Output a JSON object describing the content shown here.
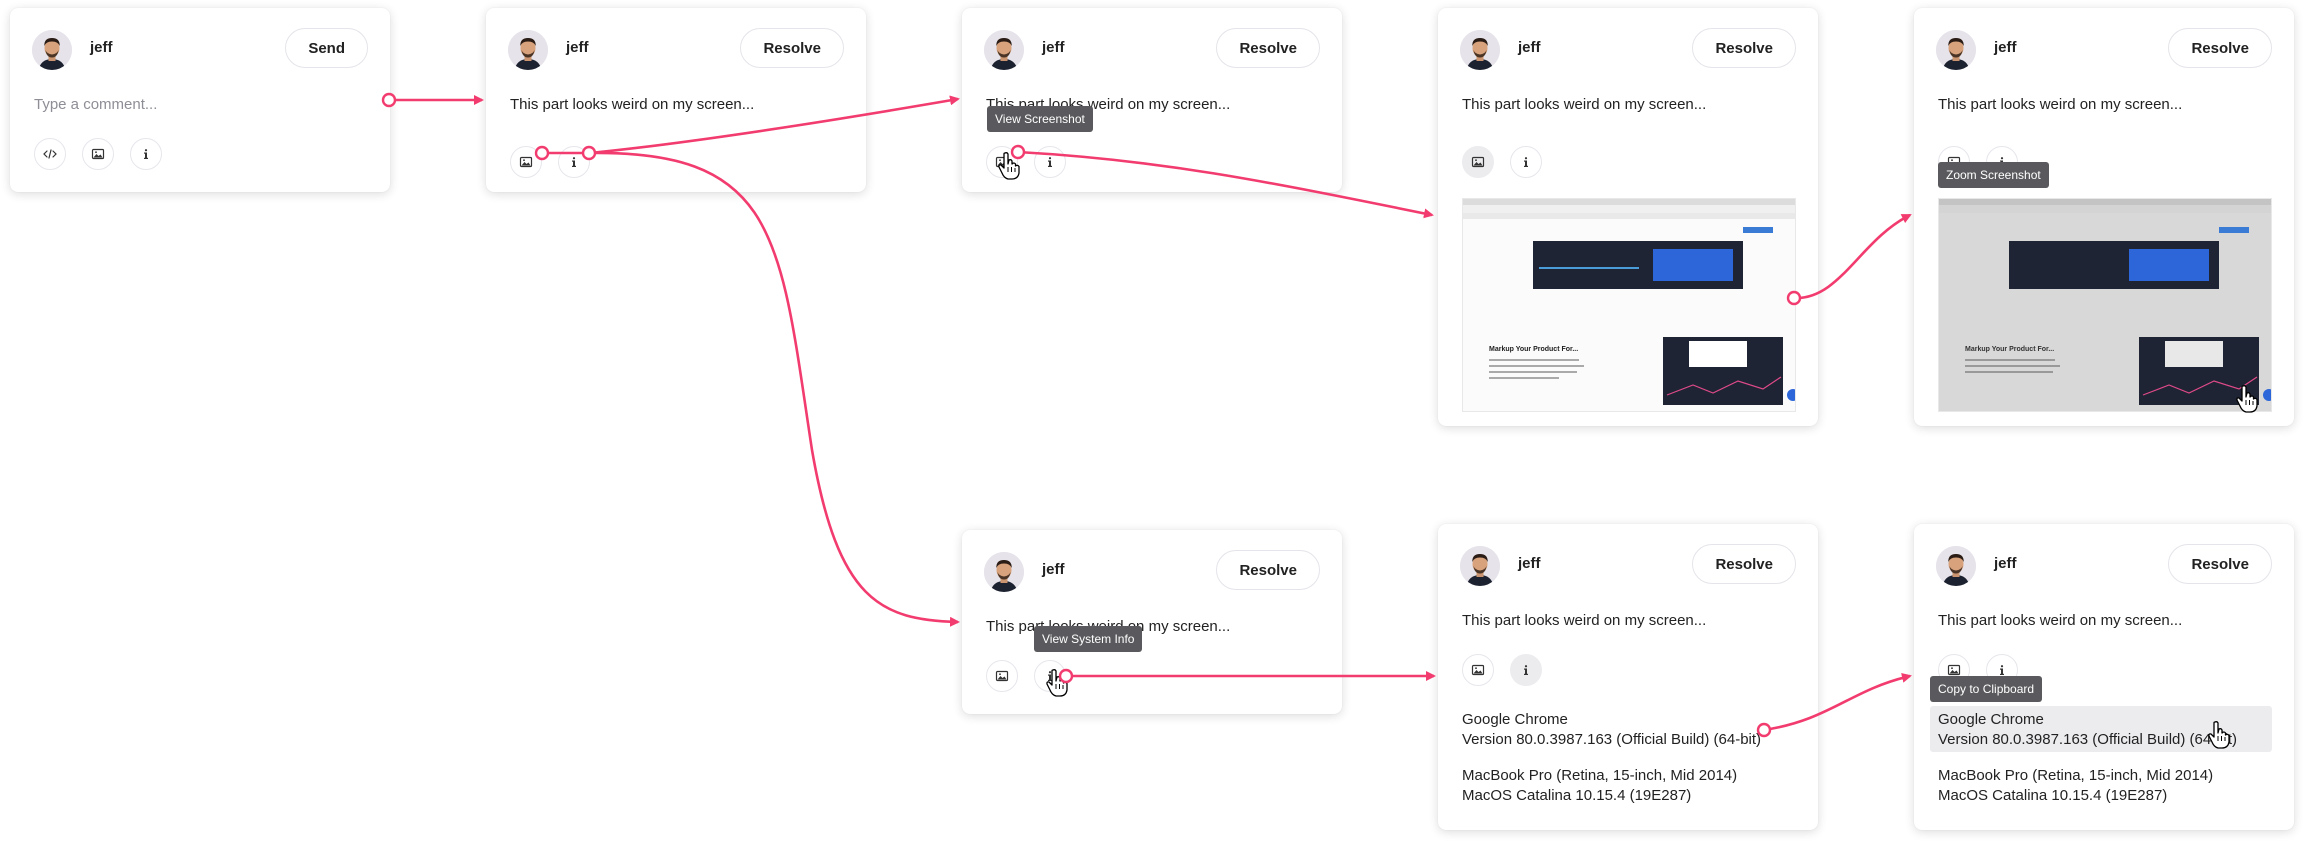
{
  "user": {
    "name": "jeff"
  },
  "buttons": {
    "send": "Send",
    "resolve": "Resolve"
  },
  "comment": {
    "placeholder": "Type a comment...",
    "message": "This part looks weird on my screen..."
  },
  "tooltips": {
    "view_screenshot": "View Screenshot",
    "zoom_screenshot": "Zoom Screenshot",
    "view_system_info": "View System Info",
    "copy_to_clipboard": "Copy to Clipboard"
  },
  "system_info": {
    "browser": "Google Chrome",
    "version": "Version 80.0.3987.163 (Official Build) (64-bit)",
    "machine": "MacBook Pro (Retina, 15-inch, Mid 2014)",
    "os": "MacOS Catalina 10.15.4 (19E287)"
  },
  "screenshot_preview": {
    "heading": "Markup Your Product For..."
  },
  "icons": {
    "code": "code-icon",
    "image": "image-icon",
    "info": "info-icon",
    "cursor": "hand-cursor-icon"
  },
  "colors": {
    "connector": "#f23b6e",
    "tooltip_bg": "#5a5a5e"
  }
}
